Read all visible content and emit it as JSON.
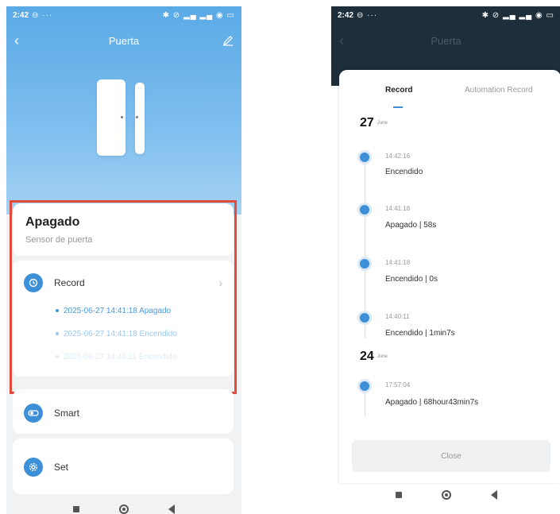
{
  "left_screen": {
    "status_bar": {
      "time": "2:42",
      "left_icons": "⊖ ···",
      "right_icons": "✱ ⊘ ▂▄ ▂▄ ◉ ▭"
    },
    "header": {
      "title": "Puerta"
    },
    "device": {
      "state": "Apagado",
      "subtitle": "Sensor de puerta"
    },
    "record_card": {
      "label": "Record",
      "entries": [
        "2025-06-27 14:41:18 Apagado",
        "2025-06-27 14:41:18 Encendido",
        "2025-06-27 14:40:11 Encendido"
      ]
    },
    "menu": {
      "smart_label": "Smart",
      "set_label": "Set"
    },
    "colors": {
      "accent": "#3d8fd8",
      "highlight": "#e24a3b"
    }
  },
  "right_screen": {
    "status_bar": {
      "time": "2:42",
      "left_icons": "⊖ ···",
      "right_icons": "✱ ⊘ ▂▄ ▂▄ ◉ ▭"
    },
    "header": {
      "title": "Puerta"
    },
    "tabs": [
      "Record",
      "Automation Record"
    ],
    "groups": [
      {
        "day": "27",
        "month": "June",
        "events": [
          {
            "time": "14:42:16",
            "text": "Encendido"
          },
          {
            "time": "14:41:18",
            "text": "Apagado  | 58s"
          },
          {
            "time": "14:41:18",
            "text": "Encendido  | 0s"
          },
          {
            "time": "14:40:11",
            "text": "Encendido  | 1min7s"
          }
        ]
      },
      {
        "day": "24",
        "month": "June",
        "events": [
          {
            "time": "17:57:04",
            "text": "Apagado  | 68hour43min7s"
          }
        ]
      }
    ],
    "close_label": "Close"
  },
  "icons": {
    "back": "chevron-left-icon",
    "edit": "pencil-icon",
    "record": "clock-icon",
    "smart": "toggle-icon",
    "set": "gear-icon",
    "chevron": "chevron-right-icon"
  }
}
